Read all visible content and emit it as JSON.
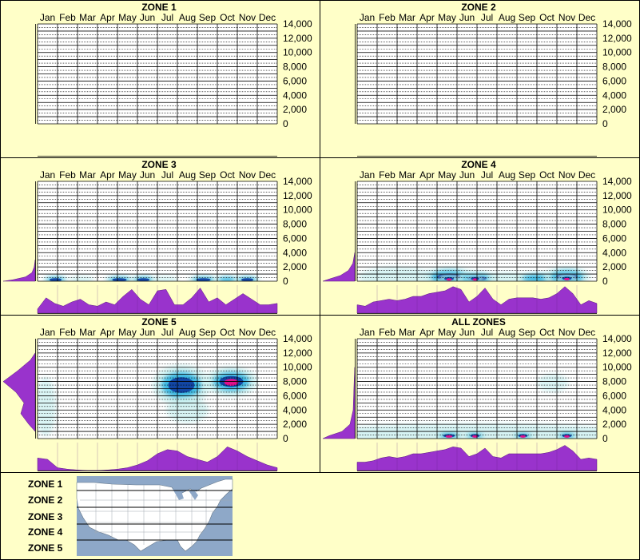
{
  "months": [
    "Jan",
    "Feb",
    "Mar",
    "Apr",
    "May",
    "Jun",
    "Jul",
    "Aug",
    "Sep",
    "Oct",
    "Nov",
    "Dec"
  ],
  "y_tick_labels": [
    "14,000",
    "12,000",
    "10,000",
    "8,000",
    "6,000",
    "4,000",
    "2,000",
    "0"
  ],
  "colors": {
    "background": "#ffffc8",
    "profile_fill": "#9933cc",
    "heat_low": "#c8f0f0",
    "heat_mid": "#2ab0e0",
    "heat_high": "#1040a0",
    "heat_peak": "#e0108c",
    "map_water": "#8ea8c8",
    "map_land": "#ffffff"
  },
  "chart_data": [
    {
      "type": "heatmap",
      "title": "ZONE 1",
      "x_categories": [
        "Jan",
        "Feb",
        "Mar",
        "Apr",
        "May",
        "Jun",
        "Jul",
        "Aug",
        "Sep",
        "Oct",
        "Nov",
        "Dec"
      ],
      "ylim": [
        0,
        14000
      ],
      "grid": true,
      "month_activity": [],
      "elevation_profile": [],
      "blobs": []
    },
    {
      "type": "heatmap",
      "title": "ZONE 2",
      "x_categories": [
        "Jan",
        "Feb",
        "Mar",
        "Apr",
        "May",
        "Jun",
        "Jul",
        "Aug",
        "Sep",
        "Oct",
        "Nov",
        "Dec"
      ],
      "ylim": [
        0,
        14000
      ],
      "grid": true,
      "month_activity": [],
      "elevation_profile": [],
      "blobs": []
    },
    {
      "type": "heatmap",
      "title": "ZONE 3",
      "x_categories": [
        "Jan",
        "Feb",
        "Mar",
        "Apr",
        "May",
        "Jun",
        "Jul",
        "Aug",
        "Sep",
        "Oct",
        "Nov",
        "Dec"
      ],
      "ylim": [
        0,
        14000
      ],
      "grid": true,
      "month_activity": [
        0.15,
        0.55,
        0.35,
        0.25,
        0.4,
        0.5,
        0.3,
        0.25,
        0.4,
        0.3,
        0.6,
        0.85,
        0.5,
        0.3,
        0.8,
        0.85,
        0.3,
        0.3,
        0.55,
        0.9,
        0.4,
        0.55,
        0.3,
        0.5,
        0.7,
        0.5,
        0.3,
        0.3,
        0.35
      ],
      "elevation_profile": [
        {
          "y": 0,
          "w": 1.0
        },
        {
          "y": 200,
          "w": 0.7
        },
        {
          "y": 600,
          "w": 0.3
        },
        {
          "y": 1200,
          "w": 0.1
        },
        {
          "y": 2000,
          "w": 0.03
        },
        {
          "y": 3000,
          "w": 0
        }
      ],
      "blobs": [
        {
          "x": 0.9,
          "y": 200,
          "rx": 0.5,
          "ry": 300,
          "i": 0.5
        },
        {
          "x": 2.2,
          "y": 200,
          "rx": 0.5,
          "ry": 250,
          "i": 0.3
        },
        {
          "x": 4.1,
          "y": 200,
          "rx": 0.6,
          "ry": 300,
          "i": 0.5
        },
        {
          "x": 5.3,
          "y": 200,
          "rx": 0.5,
          "ry": 300,
          "i": 0.7
        },
        {
          "x": 6.4,
          "y": 200,
          "rx": 0.5,
          "ry": 250,
          "i": 0.3
        },
        {
          "x": 8.3,
          "y": 200,
          "rx": 0.6,
          "ry": 300,
          "i": 0.7
        },
        {
          "x": 9.5,
          "y": 200,
          "rx": 0.5,
          "ry": 300,
          "i": 0.4
        },
        {
          "x": 10.5,
          "y": 200,
          "rx": 0.5,
          "ry": 300,
          "i": 0.5
        }
      ]
    },
    {
      "type": "heatmap",
      "title": "ZONE 4",
      "x_categories": [
        "Jan",
        "Feb",
        "Mar",
        "Apr",
        "May",
        "Jun",
        "Jul",
        "Aug",
        "Sep",
        "Oct",
        "Nov",
        "Dec"
      ],
      "ylim": [
        0,
        14000
      ],
      "grid": true,
      "month_activity": [
        0.3,
        0.25,
        0.4,
        0.45,
        0.5,
        0.45,
        0.5,
        0.6,
        0.6,
        0.7,
        0.75,
        0.8,
        0.95,
        0.85,
        0.4,
        0.6,
        0.9,
        0.5,
        0.3,
        0.5,
        0.55,
        0.55,
        0.55,
        0.5,
        0.55,
        0.7,
        0.95,
        0.7,
        0.3,
        0.45,
        0.35
      ],
      "elevation_profile": [
        {
          "y": 0,
          "w": 1.0
        },
        {
          "y": 300,
          "w": 0.8
        },
        {
          "y": 800,
          "w": 0.45
        },
        {
          "y": 1500,
          "w": 0.2
        },
        {
          "y": 2500,
          "w": 0.06
        },
        {
          "y": 4000,
          "w": 0
        }
      ],
      "blobs": [
        {
          "x": 2.0,
          "y": 600,
          "rx": 1.5,
          "ry": 900,
          "i": 0.25
        },
        {
          "x": 4.6,
          "y": 600,
          "rx": 1.0,
          "ry": 900,
          "i": 0.5
        },
        {
          "x": 6.0,
          "y": 400,
          "rx": 0.8,
          "ry": 600,
          "i": 0.5
        },
        {
          "x": 7.5,
          "y": 400,
          "rx": 0.8,
          "ry": 500,
          "i": 0.35
        },
        {
          "x": 9.0,
          "y": 400,
          "rx": 0.8,
          "ry": 500,
          "i": 0.4
        },
        {
          "x": 10.5,
          "y": 600,
          "rx": 0.9,
          "ry": 900,
          "i": 0.6
        },
        {
          "x": 4.6,
          "y": 350,
          "rx": 0.4,
          "ry": 250,
          "i": 1.0
        },
        {
          "x": 5.9,
          "y": 350,
          "rx": 0.35,
          "ry": 220,
          "i": 0.85
        },
        {
          "x": 10.5,
          "y": 400,
          "rx": 0.4,
          "ry": 300,
          "i": 1.0
        }
      ]
    },
    {
      "type": "heatmap",
      "title": "ZONE 5",
      "x_categories": [
        "Jan",
        "Feb",
        "Mar",
        "Apr",
        "May",
        "Jun",
        "Jul",
        "Aug",
        "Sep",
        "Oct",
        "Nov",
        "Dec"
      ],
      "ylim": [
        0,
        14000
      ],
      "grid": true,
      "month_activity": [
        0.45,
        0.4,
        0.1,
        0.05,
        0.02,
        0.0,
        0.0,
        0.02,
        0.05,
        0.1,
        0.2,
        0.35,
        0.6,
        0.75,
        0.7,
        0.5,
        0.4,
        0.3,
        0.5,
        0.85,
        0.7,
        0.5,
        0.35,
        0.2,
        0.1
      ],
      "elevation_profile": [
        {
          "y": 1000,
          "w": 0
        },
        {
          "y": 2000,
          "w": 0.2
        },
        {
          "y": 3500,
          "w": 0.45
        },
        {
          "y": 5000,
          "w": 0.35
        },
        {
          "y": 6500,
          "w": 0.6
        },
        {
          "y": 8000,
          "w": 1.0
        },
        {
          "y": 9500,
          "w": 0.55
        },
        {
          "y": 11000,
          "w": 0.15
        },
        {
          "y": 12000,
          "w": 0
        }
      ],
      "blobs": [
        {
          "x": 0.4,
          "y": 4500,
          "rx": 0.4,
          "ry": 3000,
          "i": 0.15
        },
        {
          "x": 7.2,
          "y": 7500,
          "rx": 1.1,
          "ry": 2000,
          "i": 0.5
        },
        {
          "x": 7.5,
          "y": 4000,
          "rx": 0.8,
          "ry": 1200,
          "i": 0.3
        },
        {
          "x": 9.7,
          "y": 8000,
          "rx": 1.0,
          "ry": 1400,
          "i": 0.75
        }
      ]
    },
    {
      "type": "heatmap",
      "title": "ALL ZONES",
      "x_categories": [
        "Jan",
        "Feb",
        "Mar",
        "Apr",
        "May",
        "Jun",
        "Jul",
        "Aug",
        "Sep",
        "Oct",
        "Nov",
        "Dec"
      ],
      "ylim": [
        0,
        14000
      ],
      "grid": true,
      "month_activity": [
        0.3,
        0.3,
        0.35,
        0.45,
        0.5,
        0.45,
        0.5,
        0.6,
        0.6,
        0.65,
        0.7,
        0.75,
        0.85,
        0.8,
        0.5,
        0.6,
        0.8,
        0.5,
        0.45,
        0.6,
        0.6,
        0.6,
        0.6,
        0.6,
        0.65,
        0.75,
        0.9,
        0.7,
        0.4,
        0.45,
        0.4
      ],
      "elevation_profile": [
        {
          "y": 0,
          "w": 1.0
        },
        {
          "y": 400,
          "w": 0.8
        },
        {
          "y": 1000,
          "w": 0.4
        },
        {
          "y": 2000,
          "w": 0.15
        },
        {
          "y": 4000,
          "w": 0.05
        },
        {
          "y": 8000,
          "w": 0.02
        },
        {
          "y": 10000,
          "w": 0
        }
      ],
      "blobs": [
        {
          "x": 6.0,
          "y": 600,
          "rx": 6.5,
          "ry": 1000,
          "i": 0.3
        },
        {
          "x": 4.6,
          "y": 400,
          "rx": 0.5,
          "ry": 300,
          "i": 1.0
        },
        {
          "x": 5.9,
          "y": 400,
          "rx": 0.4,
          "ry": 250,
          "i": 0.8
        },
        {
          "x": 8.3,
          "y": 400,
          "rx": 0.4,
          "ry": 250,
          "i": 0.8
        },
        {
          "x": 10.5,
          "y": 400,
          "rx": 0.4,
          "ry": 300,
          "i": 1.0
        },
        {
          "x": 9.8,
          "y": 7800,
          "rx": 0.6,
          "ry": 800,
          "i": 0.15
        }
      ]
    }
  ],
  "legend": {
    "zones": [
      "ZONE 1",
      "ZONE 2",
      "ZONE 3",
      "ZONE 4",
      "ZONE 5"
    ]
  }
}
